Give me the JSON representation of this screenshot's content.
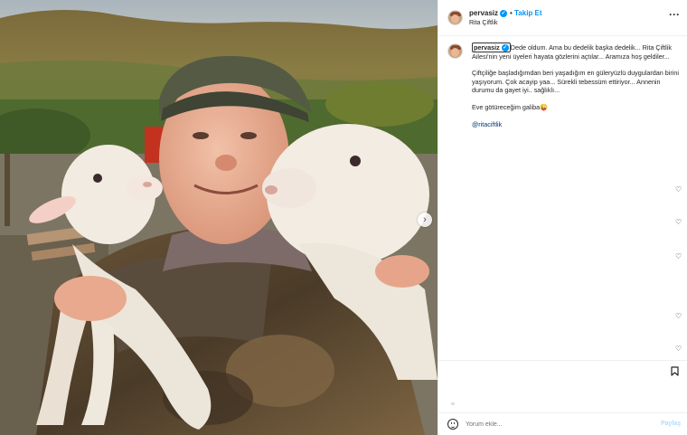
{
  "post": {
    "username": "pervasiz",
    "verified_mark": "✓",
    "separator": "•",
    "follow_label": "Takip Et",
    "location": "Rita Çiftlik",
    "more_icon": "more-horizontal-icon",
    "next_icon": "chevron-right-icon"
  },
  "caption": {
    "username": "pervasiz",
    "line1_rest": "Dede oldum. Ama bu dedelik başka dedelik... Rita Çiftlik Ailesi'nin yeni üyeleri hayata gözlerini açtılar... Aramıza hoş geldiler...",
    "para2": "Çiftçiliğe başladığımdan beri yaşadığım en güleryüzlü duygulardan birini yaşıyorum. Çok acayip yaa... Sürekli tebessüm ettiriyor... Annenin durumu da gayet iyi.. sağlıklı...",
    "para3": "Eve götüreceğim galiba",
    "para3_emoji": "😜",
    "tag": "@ritaciftlik"
  },
  "hearts": [
    "♡",
    "♡",
    "♡",
    "♡",
    "♡"
  ],
  "comment": {
    "placeholder": "Yorum ekle...",
    "post_label": "Paylaş"
  }
}
